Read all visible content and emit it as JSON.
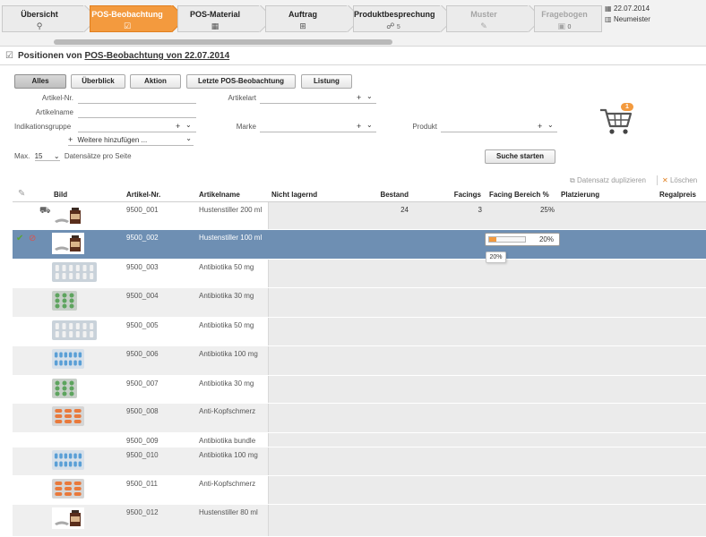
{
  "colors": {
    "accent": "#f39a3e",
    "selected_row": "#6e8fb3",
    "check": "#5aa532",
    "forbid": "#d9534f"
  },
  "header": {
    "steps": [
      {
        "label": "Übersicht",
        "icon": "search-icon",
        "icon_glyph": "⚲",
        "count": "",
        "state": "normal"
      },
      {
        "label": "POS-Beobachtung",
        "icon": "checklist-icon",
        "icon_glyph": "☑",
        "count": "",
        "state": "active"
      },
      {
        "label": "POS-Material",
        "icon": "grid-icon",
        "icon_glyph": "▦",
        "count": "",
        "state": "normal"
      },
      {
        "label": "Auftrag",
        "icon": "cart-icon",
        "icon_glyph": "🛒",
        "count": "",
        "state": "normal"
      },
      {
        "label": "Produktbesprechung",
        "icon": "chat-icon",
        "icon_glyph": "☍",
        "count": "5",
        "state": "normal"
      },
      {
        "label": "Muster",
        "icon": "sample-icon",
        "icon_glyph": "✎",
        "count": "",
        "state": "disabled"
      },
      {
        "label": "Fragebogen",
        "icon": "questionnaire-icon",
        "icon_glyph": "▣",
        "count": "0",
        "state": "disabled"
      }
    ],
    "date": "22.07.2014",
    "location": "Neumeister"
  },
  "page": {
    "title_prefix": "Positionen von",
    "title_link": "POS-Beobachtung von 22.07.2014"
  },
  "filters": {
    "tabs": [
      "Alles",
      "Überblick",
      "Aktion",
      "Letzte POS-Beobachtung",
      "Listung"
    ],
    "selected": "Alles"
  },
  "form": {
    "artikel_nr": "Artikel-Nr.",
    "artikelname": "Artikelname",
    "indikationsgruppe": "Indikationsgruppe",
    "artikelart": "Artikelart",
    "marke": "Marke",
    "produkt": "Produkt",
    "add_more": "Weitere hinzufügen ...",
    "max_label": "Max.",
    "max_value": "15",
    "per_page": "Datensätze pro Seite",
    "search_button": "Suche starten"
  },
  "cart": {
    "badge": "1"
  },
  "grid_toolbar": {
    "duplicate": "Datensatz duplizieren",
    "delete": "Löschen"
  },
  "table": {
    "columns": {
      "bild": "Bild",
      "artikel_nr": "Artikel-Nr.",
      "artikelname": "Artikelname",
      "nicht_lagernd": "Nicht lagernd",
      "bestand": "Bestand",
      "facings": "Facings",
      "facing_bereich": "Facing Bereich %",
      "platzierung": "Platzierung",
      "regalpreis": "Regalpreis"
    },
    "rows": [
      {
        "nr": "9500_001",
        "name": "Hustenstiller 200 ml",
        "bestand": "24",
        "facings": "3",
        "facing_bereich": "25%",
        "thumb": "bottle",
        "icon": "cart"
      },
      {
        "nr": "9500_002",
        "name": "Hustenstiller 100 ml",
        "bestand": "",
        "facings": "",
        "facing_bereich": "20%",
        "thumb": "bottle",
        "icon": "selected",
        "progress": 0.2
      },
      {
        "nr": "9500_003",
        "name": "Antibiotika 50 mg",
        "bestand": "",
        "facings": "",
        "facing_bereich": "",
        "thumb": "white-pills"
      },
      {
        "nr": "9500_004",
        "name": "Antibiotika 30 mg",
        "bestand": "",
        "facings": "",
        "facing_bereich": "",
        "thumb": "green-pills"
      },
      {
        "nr": "9500_005",
        "name": "Antibiotika 50 mg",
        "bestand": "",
        "facings": "",
        "facing_bereich": "",
        "thumb": "white-pills"
      },
      {
        "nr": "9500_006",
        "name": "Antibiotika 100 mg",
        "bestand": "",
        "facings": "",
        "facing_bereich": "",
        "thumb": "blue-pills"
      },
      {
        "nr": "9500_007",
        "name": "Antibiotika 30 mg",
        "bestand": "",
        "facings": "",
        "facing_bereich": "",
        "thumb": "green-pills"
      },
      {
        "nr": "9500_008",
        "name": "Anti-Kopfschmerz",
        "bestand": "",
        "facings": "",
        "facing_bereich": "",
        "thumb": "orange-pills"
      },
      {
        "nr": "9500_009",
        "name": "Antibiotika bundle",
        "bestand": "",
        "facings": "",
        "facing_bereich": "",
        "thumb": "none"
      },
      {
        "nr": "9500_010",
        "name": "Antibiotika 100 mg",
        "bestand": "",
        "facings": "",
        "facing_bereich": "",
        "thumb": "blue-pills"
      },
      {
        "nr": "9500_011",
        "name": "Anti-Kopfschmerz",
        "bestand": "",
        "facings": "",
        "facing_bereich": "",
        "thumb": "orange-pills"
      },
      {
        "nr": "9500_012",
        "name": "Hustenstiller 80 ml",
        "bestand": "",
        "facings": "",
        "facing_bereich": "",
        "thumb": "bottle"
      }
    ],
    "tooltip": "20%"
  }
}
